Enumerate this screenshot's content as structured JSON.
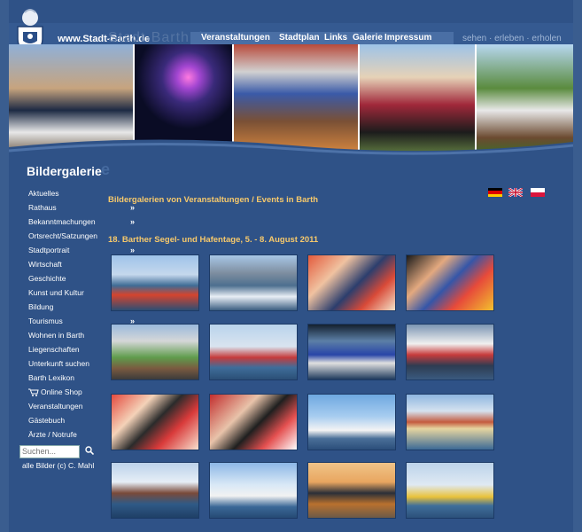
{
  "site": {
    "url": "www.Stadt-Barth.de",
    "url_ghost": "Stadt-Barth.de",
    "tagline": "sehen · erleben · erholen"
  },
  "nav": [
    "Veranstaltungen",
    "Stadtplan",
    "Links",
    "Galerie",
    "Impressum"
  ],
  "section": {
    "title": "Bildergalerie",
    "ghost": "e"
  },
  "sidebar": [
    {
      "label": "Aktuelles",
      "arrow": ""
    },
    {
      "label": "Rathaus",
      "arrow": "»"
    },
    {
      "label": "Bekanntmachungen",
      "arrow": "»"
    },
    {
      "label": "Ortsrecht/Satzungen",
      "arrow": ""
    },
    {
      "label": "Stadtportrait",
      "arrow": "»"
    },
    {
      "label": "Wirtschaft",
      "arrow": "»"
    },
    {
      "label": "Geschichte",
      "arrow": "»"
    },
    {
      "label": "Kunst und Kultur",
      "arrow": "»"
    },
    {
      "label": "Bildung",
      "arrow": "»"
    },
    {
      "label": "Tourismus",
      "arrow": "»"
    },
    {
      "label": "Wohnen in Barth",
      "arrow": ""
    },
    {
      "label": "Liegenschaften",
      "arrow": ""
    },
    {
      "label": "Unterkunft suchen",
      "arrow": ""
    },
    {
      "label": "Barth Lexikon",
      "arrow": ""
    },
    {
      "label": "Online Shop",
      "arrow": ""
    },
    {
      "label": "Veranstaltungen",
      "arrow": ""
    },
    {
      "label": "Gästebuch",
      "arrow": ""
    },
    {
      "label": "Ärzte / Notrufe",
      "arrow": ""
    }
  ],
  "search": {
    "placeholder": "Suchen..."
  },
  "credits": "alle Bilder (c) C. Mahl",
  "gallery": {
    "header": "Bildergalerien von Veranstaltungen / Events in Barth",
    "event": "18. Barther Segel- und Hafentage, 5. - 8. August 2011"
  },
  "languages": [
    "Deutsch",
    "English",
    "Polski"
  ],
  "colors": {
    "background": "#2f5287",
    "accent": "#f7c96b"
  }
}
